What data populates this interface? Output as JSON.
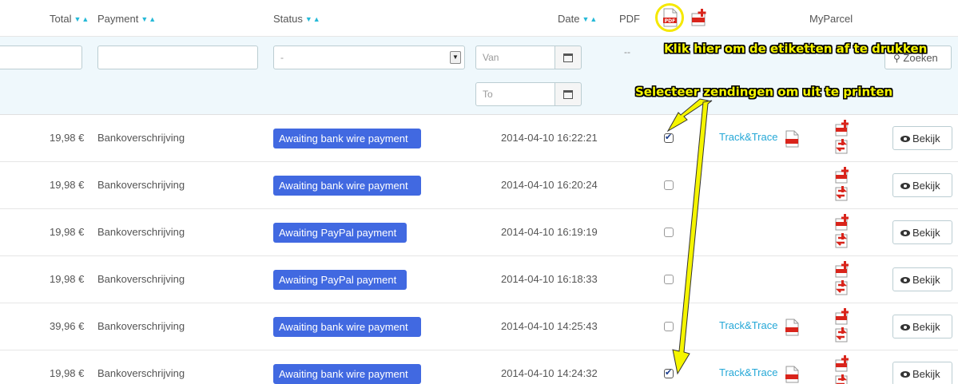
{
  "header": {
    "total": "Total",
    "payment": "Payment",
    "status": "Status",
    "date": "Date",
    "pdf": "PDF",
    "myparcel": "MyParcel",
    "pdf_icon_label": "PDF"
  },
  "filters": {
    "status_value": "-",
    "date_from_placeholder": "Van",
    "date_to_placeholder": "To",
    "pdf_dash": "--",
    "search_label": "Zoeken"
  },
  "annotations": {
    "print_hint": "Klik hier om de etiketten af te drukken",
    "select_hint": "Selecteer zendingen om uit te printen"
  },
  "rows": [
    {
      "total": "19,98 €",
      "payment": "Bankoverschrijving",
      "status": "Awaiting bank wire payment",
      "date": "2014-04-10 16:22:21",
      "checked": true,
      "track": "Track&Trace",
      "view": "Bekijk"
    },
    {
      "total": "19,98 €",
      "payment": "Bankoverschrijving",
      "status": "Awaiting bank wire payment",
      "date": "2014-04-10 16:20:24",
      "checked": false,
      "track": "",
      "view": "Bekijk"
    },
    {
      "total": "19,98 €",
      "payment": "Bankoverschrijving",
      "status": "Awaiting PayPal payment",
      "date": "2014-04-10 16:19:19",
      "checked": false,
      "track": "",
      "view": "Bekijk"
    },
    {
      "total": "19,98 €",
      "payment": "Bankoverschrijving",
      "status": "Awaiting PayPal payment",
      "date": "2014-04-10 16:18:33",
      "checked": false,
      "track": "",
      "view": "Bekijk"
    },
    {
      "total": "39,96 €",
      "payment": "Bankoverschrijving",
      "status": "Awaiting bank wire payment",
      "date": "2014-04-10 14:25:43",
      "checked": false,
      "track": "Track&Trace",
      "view": "Bekijk"
    },
    {
      "total": "19,98 €",
      "payment": "Bankoverschrijving",
      "status": "Awaiting bank wire payment",
      "date": "2014-04-10 14:24:32",
      "checked": true,
      "track": "Track&Trace",
      "view": "Bekijk"
    }
  ],
  "colors": {
    "status_badge": "#4169e1",
    "link": "#25a8d7",
    "annotation": "#f5f500",
    "filter_bg": "#eff8fc"
  },
  "icons": {
    "sort": "sort-arrows-icon",
    "pdf": "pdf-file-icon",
    "pdf_add": "pdf-add-icon",
    "calendar": "calendar-icon",
    "search": "magnifier-icon",
    "eye": "eye-icon"
  }
}
